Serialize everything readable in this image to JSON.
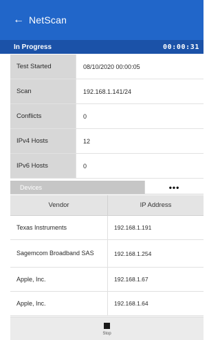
{
  "appbar": {
    "back_icon": "←",
    "title": "NetScan"
  },
  "progress": {
    "label": "In Progress",
    "timer": "00:00:31"
  },
  "info": [
    {
      "key": "Test Started",
      "value": "08/10/2020 00:00:05"
    },
    {
      "key": "Scan",
      "value": "192.168.1.141/24"
    },
    {
      "key": "Conflicts",
      "value": "0"
    },
    {
      "key": "IPv4 Hosts",
      "value": "12"
    },
    {
      "key": "IPv6 Hosts",
      "value": "0"
    }
  ],
  "devices": {
    "tab_label": "Devices",
    "more_icon": "•••"
  },
  "table": {
    "headers": [
      "Vendor",
      "IP Address"
    ],
    "rows": [
      {
        "vendor": "Texas Instruments",
        "ip": "192.168.1.191"
      },
      {
        "vendor": "Sagemcom Broadband SAS",
        "ip": "192.168.1.254"
      },
      {
        "vendor": "Apple, Inc.",
        "ip": "192.168.1.67"
      },
      {
        "vendor": "Apple, Inc.",
        "ip": "192.168.1.64"
      }
    ]
  },
  "footer": {
    "stop_label": "Stop"
  },
  "colors": {
    "appbar": "#2166c9",
    "progress_bar": "#1b52a8",
    "key_cell": "#d7d7d7"
  }
}
